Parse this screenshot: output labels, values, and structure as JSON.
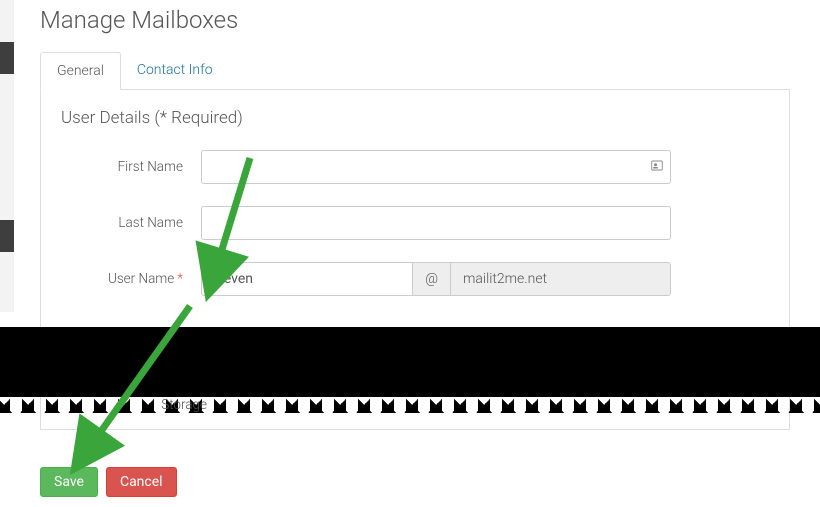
{
  "page": {
    "title": "Manage Mailboxes"
  },
  "tabs": {
    "general": "General",
    "contact": "Contact Info"
  },
  "section": {
    "title": "User Details (* Required)"
  },
  "fields": {
    "first_name": {
      "label": "First Name",
      "value": ""
    },
    "last_name": {
      "label": "Last Name",
      "value": ""
    },
    "user_name": {
      "label": "User Name",
      "value": "steven",
      "at": "@",
      "domain": "mailit2me.net"
    },
    "storage": {
      "label": "Storage"
    }
  },
  "buttons": {
    "save": "Save",
    "cancel": "Cancel"
  },
  "colors": {
    "save": "#5cb85c",
    "cancel": "#d9534f",
    "link": "#1a6f9e",
    "arrow": "#3aa53a"
  }
}
